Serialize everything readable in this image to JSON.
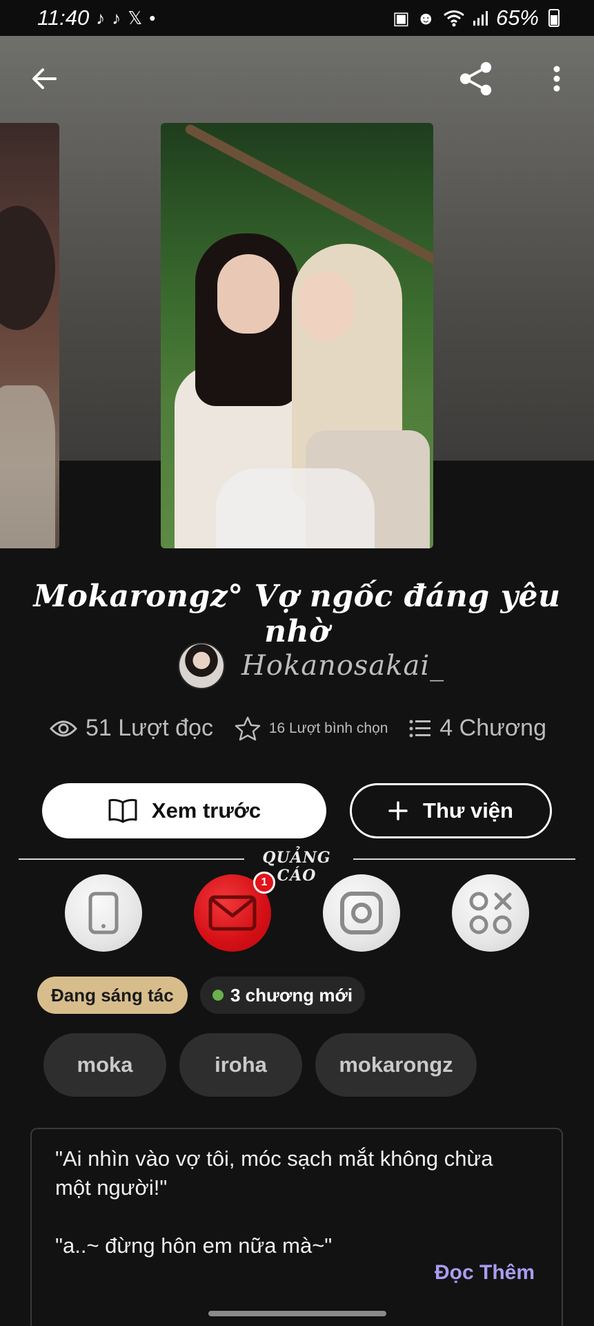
{
  "status_bar": {
    "time": "11:40",
    "battery": "65%",
    "notification_icons": [
      "tiktok-icon",
      "tiktok-icon",
      "x-icon",
      "dot-icon"
    ],
    "system_icons": [
      "battery-saver-icon",
      "cat-icon",
      "wifi-icon",
      "signal-icon"
    ]
  },
  "topbar": {
    "back_icon": "arrow-left-icon",
    "share_icon": "share-icon",
    "more_icon": "more-vertical-icon"
  },
  "book": {
    "title": "Mokarongz° Vợ ngốc đáng yêu nhờ",
    "author": "Hokanosakai_",
    "stats": {
      "reads": "51 Lượt đọc",
      "votes": "16 Lượt bình chọn",
      "chapters": "4 Chương"
    }
  },
  "actions": {
    "preview_label": "Xem trước",
    "library_label": "Thư viện"
  },
  "ad": {
    "label": "QUẢNG CÁO",
    "icons": [
      {
        "name": "phone-icon",
        "badge": ""
      },
      {
        "name": "mail-icon",
        "badge": "1"
      },
      {
        "name": "instagram-icon",
        "badge": ""
      },
      {
        "name": "apps-grid-icon",
        "badge": ""
      }
    ]
  },
  "status_pills": {
    "writing": "Đang sáng tác",
    "new_chapters": "3 chương mới"
  },
  "tags": [
    "moka",
    "iroha",
    "mokarongz"
  ],
  "description": {
    "line1": "\"Ai nhìn vào vợ tôi, móc sạch mắt không chừa",
    "line2": "một người!\"",
    "line3": "\"a..~ đừng hôn em nữa mà~\"",
    "read_more": "Đọc Thêm"
  },
  "colors": {
    "status_pill": "#d8bd8c",
    "read_more": "#a99cf0",
    "new_dot": "#6ab04c",
    "mail_red": "#d40f15"
  }
}
